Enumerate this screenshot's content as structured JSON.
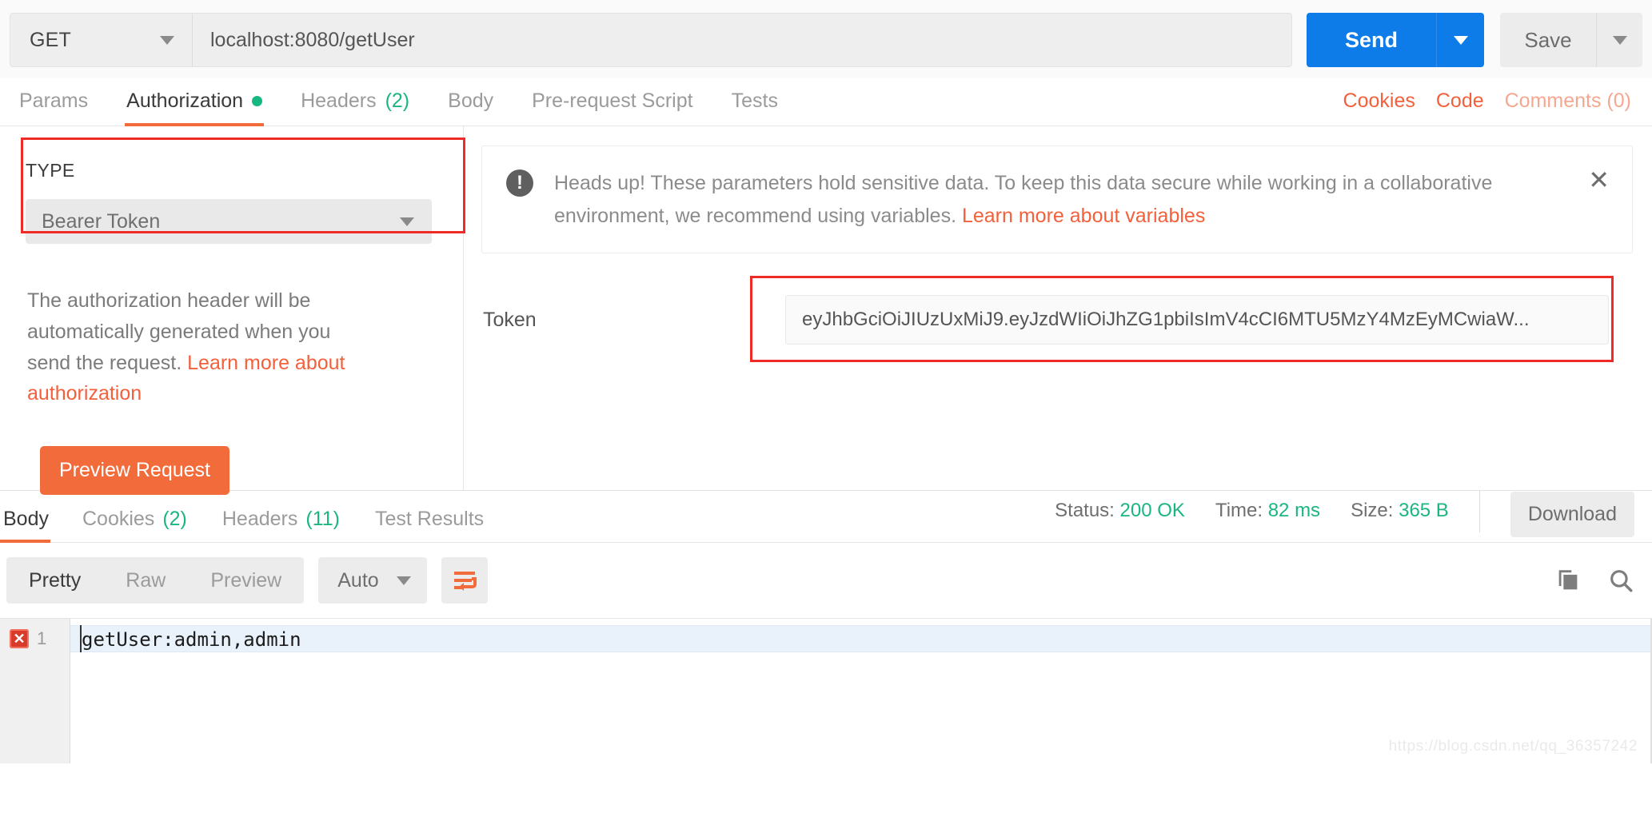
{
  "request_bar": {
    "method": "GET",
    "url": "localhost:8080/getUser",
    "send_label": "Send",
    "save_label": "Save"
  },
  "request_tabs": [
    {
      "label": "Params",
      "active": false,
      "badge": "",
      "dot": false
    },
    {
      "label": "Authorization",
      "active": true,
      "badge": "",
      "dot": true
    },
    {
      "label": "Headers",
      "active": false,
      "badge": "(2)",
      "dot": false
    },
    {
      "label": "Body",
      "active": false,
      "badge": "",
      "dot": false
    },
    {
      "label": "Pre-request Script",
      "active": false,
      "badge": "",
      "dot": false
    },
    {
      "label": "Tests",
      "active": false,
      "badge": "",
      "dot": false
    }
  ],
  "tabs_right": {
    "cookies": "Cookies",
    "code": "Code",
    "comments": "Comments (0)"
  },
  "auth": {
    "type_label": "TYPE",
    "type_value": "Bearer Token",
    "description_part1": "The authorization header will be automatically generated when you send the request. ",
    "description_link": "Learn more about authorization",
    "preview_button": "Preview Request",
    "token_label": "Token",
    "token_value": "eyJhbGciOiJIUzUxMiJ9.eyJzdWIiOiJhZG1pbiIsImV4cCI6MTU5MzY4MzEyMCwiaW..."
  },
  "notice": {
    "icon": "exclamation-icon",
    "text_part1": "Heads up! These parameters hold sensitive data. To keep this data secure while working in a collaborative environment, we recommend using variables. ",
    "link": "Learn more about variables",
    "close": "✕"
  },
  "response_tabs": [
    {
      "label": "Body",
      "badge": "",
      "active": true
    },
    {
      "label": "Cookies",
      "badge": "(2)",
      "active": false
    },
    {
      "label": "Headers",
      "badge": "(11)",
      "active": false
    },
    {
      "label": "Test Results",
      "badge": "",
      "active": false
    }
  ],
  "response_meta": {
    "status_label": "Status:",
    "status_value": "200 OK",
    "time_label": "Time:",
    "time_value": "82 ms",
    "size_label": "Size:",
    "size_value": "365 B",
    "download_label": "Download"
  },
  "format_bar": {
    "segments": [
      {
        "label": "Pretty",
        "active": true
      },
      {
        "label": "Raw",
        "active": false
      },
      {
        "label": "Preview",
        "active": false
      }
    ],
    "auto_label": "Auto",
    "wrap_icon": "word-wrap-icon",
    "copy_icon": "copy-icon",
    "search_icon": "search-icon"
  },
  "editor": {
    "line_number": "1",
    "error_mark": "✕",
    "content": "getUser:admin,admin"
  },
  "watermark": "https://blog.csdn.net/qq_36357242",
  "colors": {
    "accent_orange": "#f26b3a",
    "send_blue": "#0d7ce8",
    "success_green": "#1bb584",
    "annotation_red": "#ee2b26"
  }
}
